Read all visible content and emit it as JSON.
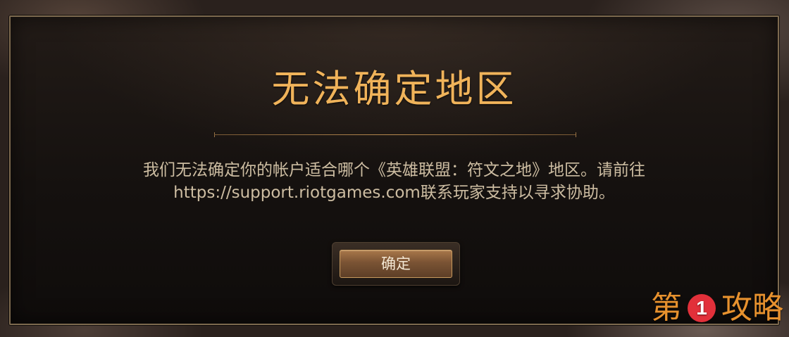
{
  "dialog": {
    "title": "无法确定地区",
    "message_line1": "我们无法确定你的帐户适合哪个《英雄联盟：符文之地》地区。请前往",
    "message_line2": "https://support.riotgames.com联系玩家支持以寻求协助。",
    "ok_label": "确定"
  },
  "watermark": {
    "prefix": "第",
    "number": "1",
    "suffix": "攻略"
  },
  "colors": {
    "title": "#f0b35a",
    "message": "#cdbda2",
    "button": "#7a5334",
    "watermark": "#e7912e",
    "badge": "#e2303a"
  }
}
